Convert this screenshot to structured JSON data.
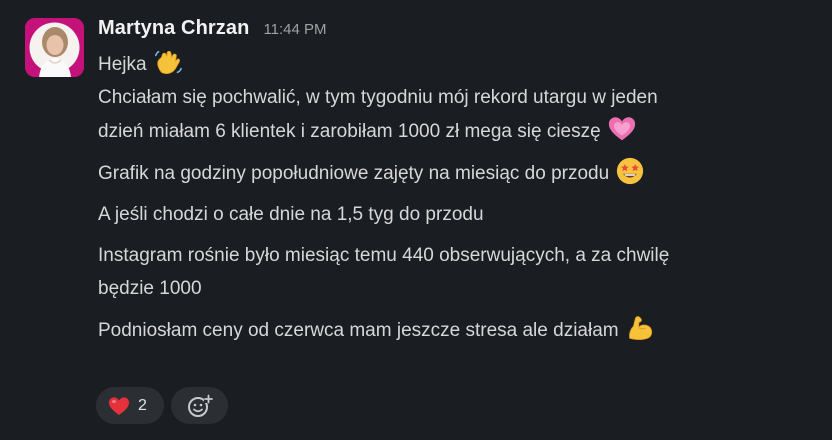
{
  "message": {
    "sender": "Martyna Chrzan",
    "time": "11:44 PM",
    "lines": [
      "Hejka",
      "Chciałam się pochwalić, w tym tygodniu mój rekord utargu w jeden",
      "dzień miałam 6 klientek i zarobiłam 1000 zł mega się cieszę",
      "Grafik na godziny popołudniowe zajęty na miesiąc do przodu",
      "A jeśli chodzi o całe dnie na 1,5 tyg do przodu",
      "Instagram rośnie było miesiąc temu 440 obserwujących, a za chwilę",
      "będzie 1000",
      "Podniosłam ceny od czerwca mam jeszcze stresa ale działam"
    ],
    "emojis": [
      "waving-hand",
      "pink-heart",
      "star-struck-face",
      "flexed-biceps"
    ]
  },
  "reactions": [
    {
      "emoji": "red-heart",
      "count": "2"
    },
    {
      "emoji": "add-reaction-icon"
    }
  ],
  "colors": {
    "background": "#1a1d21",
    "text": "#d6d7d8",
    "sender": "#f2f2f2",
    "timestamp": "#a0a1a3",
    "reaction_bg": "#2b2e33"
  }
}
